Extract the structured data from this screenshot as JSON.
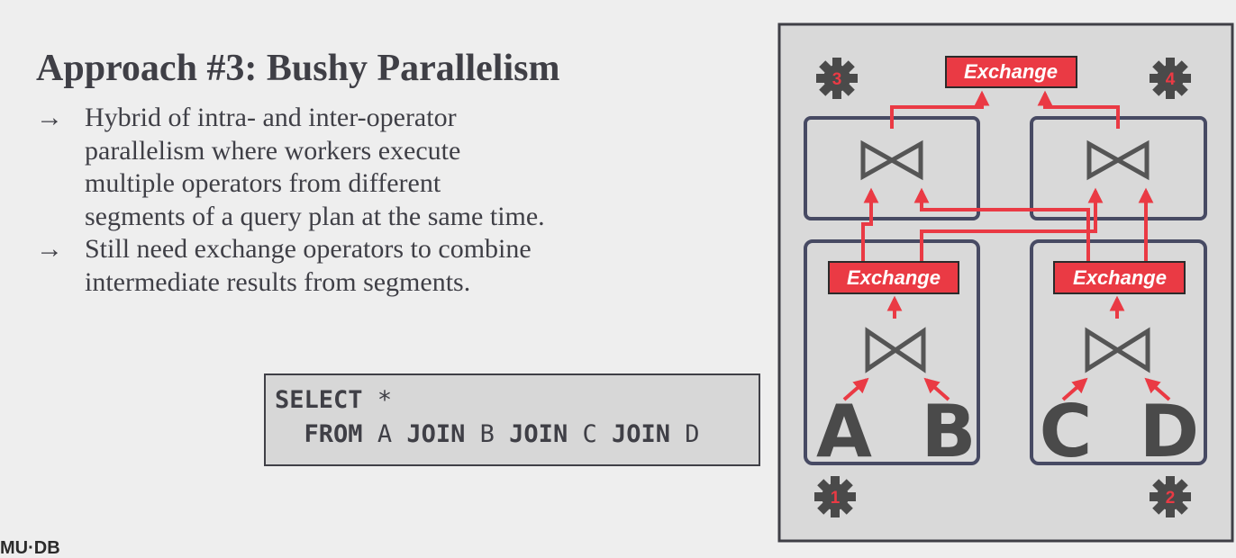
{
  "title": "Approach #3: Bushy Parallelism",
  "bullets": [
    {
      "arrow": "→",
      "lines": [
        "Hybrid of intra- and inter-operator",
        "parallelism where workers execute",
        "multiple operators from different",
        "segments of a query plan at the same time."
      ]
    },
    {
      "arrow": "→",
      "lines": [
        "Still need exchange operators to combine",
        "intermediate results from segments."
      ]
    }
  ],
  "sql": {
    "select_kw": "SELECT",
    "star": "*",
    "from_kw": "FROM",
    "table_a": "A",
    "join_kw": "JOIN",
    "table_b": "B",
    "table_c": "C",
    "table_d": "D"
  },
  "diagram": {
    "exchange_label": "Exchange",
    "tables": [
      "A",
      "B",
      "C",
      "D"
    ],
    "workers": [
      "1",
      "2",
      "3",
      "4"
    ],
    "colors": {
      "panel": "#d9d9d9",
      "dark": "#3f3f46",
      "box": "#474a63",
      "red": "#ea3a44",
      "join": "#555555",
      "gear": "#4a4a4a"
    }
  },
  "footer": {
    "logo": "MU·DB"
  }
}
